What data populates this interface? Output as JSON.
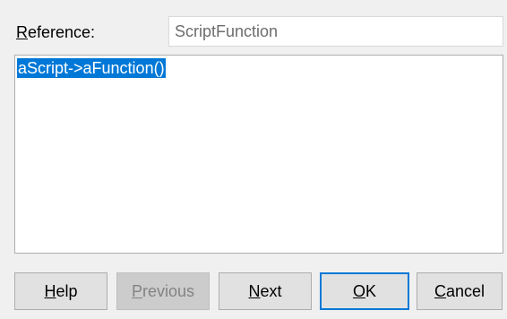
{
  "reference": {
    "label_mnemonic": "R",
    "label_rest": "eference:",
    "value": "ScriptFunction"
  },
  "editor": {
    "text": "aScript->aFunction()",
    "selection_color": "#0078d7"
  },
  "buttons": {
    "help": {
      "mnemonic": "H",
      "rest": "elp"
    },
    "previous": {
      "mnemonic": "P",
      "rest": "revious",
      "enabled": false
    },
    "next": {
      "mnemonic": "N",
      "rest": "ext"
    },
    "ok": {
      "mnemonic": "O",
      "rest": "K",
      "default": true
    },
    "cancel": {
      "mnemonic": "C",
      "rest": "ancel"
    }
  },
  "colors": {
    "dialog_bg": "#f0f0f0",
    "accent": "#0078d7"
  }
}
